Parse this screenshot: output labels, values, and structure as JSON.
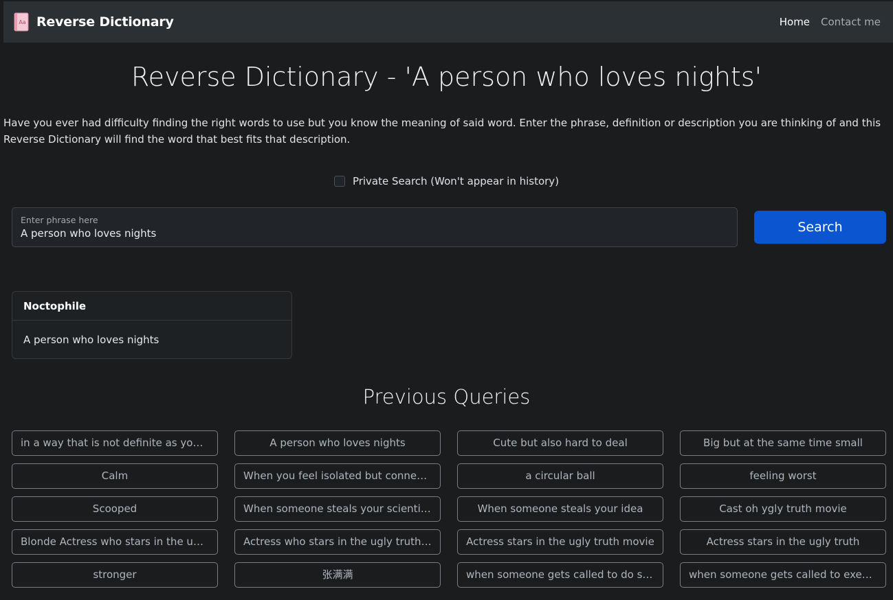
{
  "navbar": {
    "brand": "Reverse Dictionary",
    "links": [
      {
        "label": "Home",
        "active": true
      },
      {
        "label": "Contact me",
        "active": false
      }
    ]
  },
  "heading": "Reverse Dictionary - 'A person who loves nights'",
  "intro": "Have you ever had difficulty finding the right words to use but you know the meaning of said word. Enter the phrase, definition or description you are thinking of and this Reverse Dictionary will find the word that best fits that description.",
  "private_search": {
    "label": "Private Search (Won't appear in history)",
    "checked": false
  },
  "search": {
    "label": "Enter phrase here",
    "value": "A person who loves nights",
    "button_label": "Search"
  },
  "result": {
    "word": "Noctophile",
    "definition": "A person who loves nights"
  },
  "previous_queries": {
    "title": "Previous Queries",
    "items": [
      "in a way that is not definite as you m...",
      "A person who loves nights",
      "Cute but also hard to deal",
      "Big but at the same time small",
      "Calm",
      "When you feel isolated but connecte...",
      "a circular ball",
      "feeling worst",
      "Scooped",
      "When someone steals your scientific ...",
      "When someone steals your idea",
      "Cast oh ygly truth movie",
      "Blonde Actress who stars in the ugly ...",
      "Actress who stars in the ugly truth m...",
      "Actress stars in the ugly truth movie",
      "Actress stars in the ugly truth",
      "stronger",
      "张满满",
      "when someone gets called to do so...",
      "when someone gets called to execut..."
    ]
  },
  "colors": {
    "background": "#1b1c1e",
    "navbar": "#2b3035",
    "primary": "#0b56d0",
    "query_border": "#7a7f85"
  },
  "icons": {
    "brand": "dictionary-book-icon"
  }
}
